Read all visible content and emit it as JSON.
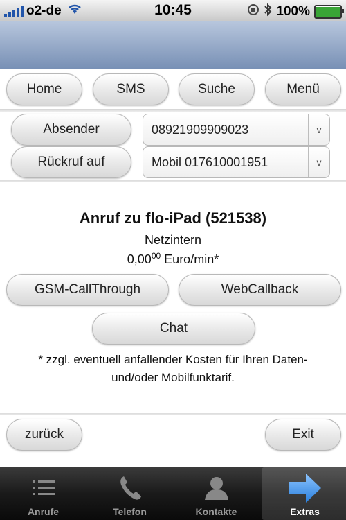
{
  "status_bar": {
    "carrier": "o2-de",
    "time": "10:45",
    "battery": "100%"
  },
  "top_nav": {
    "home": "Home",
    "sms": "SMS",
    "suche": "Suche",
    "menu": "Menü"
  },
  "form": {
    "absender_label": "Absender",
    "absender_value": "08921909909023",
    "rueckruf_label": "Rückruf auf",
    "rueckruf_value": "Mobil 017610001951",
    "dropdown_arrow": "v"
  },
  "call": {
    "title": "Anruf zu flo-iPad (521538)",
    "type": "Netzintern",
    "price_main": "0,00",
    "price_sup": "00",
    "price_unit": " Euro/min*",
    "gsm_button": "GSM-CallThrough",
    "webcallback_button": "WebCallback",
    "chat_button": "Chat",
    "note_line1": "* zzgl. eventuell anfallender Kosten für Ihren Daten-",
    "note_line2": "und/oder Mobilfunktarif."
  },
  "bottom_nav": {
    "back": "zurück",
    "exit": "Exit"
  },
  "tab_bar": {
    "tabs": [
      {
        "label": "Anrufe",
        "icon": "list-icon"
      },
      {
        "label": "Telefon",
        "icon": "phone-icon"
      },
      {
        "label": "Kontakte",
        "icon": "contact-icon"
      },
      {
        "label": "Extras",
        "icon": "arrow-right-icon"
      }
    ],
    "active_index": 3,
    "accent": "#3c8fe6"
  }
}
